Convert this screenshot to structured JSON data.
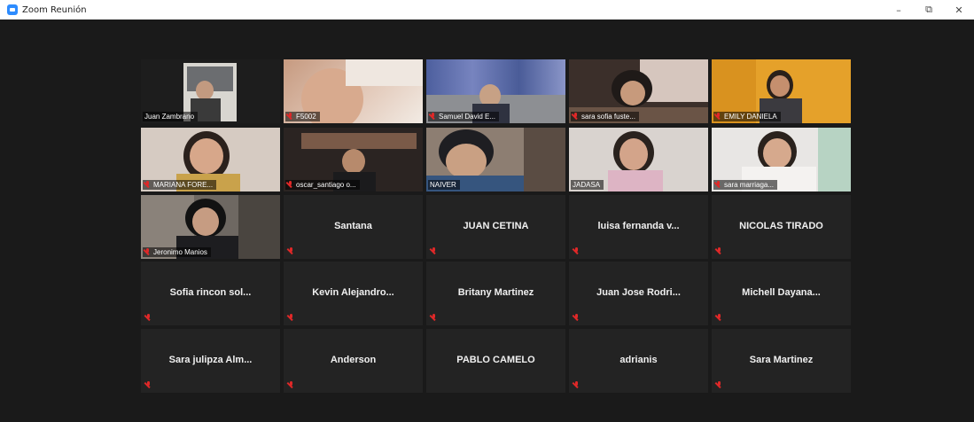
{
  "window": {
    "title": "Zoom Reunión",
    "minimize": "–",
    "restore": "⧉",
    "close": "✕"
  },
  "participants": [
    {
      "name": "Juan Zambrano",
      "label": "Juan Zambrano",
      "video": true,
      "active": true,
      "muted": false
    },
    {
      "name": "F5002",
      "label": "F5002",
      "video": true,
      "muted": true
    },
    {
      "name": "Samuel David E...",
      "label": "Samuel David E...",
      "video": true,
      "muted": true
    },
    {
      "name": "sara sofia fuste...",
      "label": "sara sofia fuste...",
      "video": true,
      "muted": true
    },
    {
      "name": "EMILY DANIELA",
      "label": "EMILY DANIELA",
      "video": true,
      "muted": true
    },
    {
      "name": "MARIANA FORE...",
      "label": "MARIANA FORE...",
      "video": true,
      "muted": true
    },
    {
      "name": "oscar_santiago o...",
      "label": "oscar_santiago o...",
      "video": true,
      "muted": true
    },
    {
      "name": "NAIVER",
      "label": "NAIVER",
      "video": true,
      "muted": false
    },
    {
      "name": "JADASA",
      "label": "JADASA",
      "video": true,
      "muted": false
    },
    {
      "name": "sara marriaga...",
      "label": "sara marriaga...",
      "video": true,
      "muted": true
    },
    {
      "name": "Jeronimo Manios",
      "label": "Jeronimo Manios",
      "video": true,
      "muted": true
    },
    {
      "name": "Santana",
      "video": false,
      "muted": true
    },
    {
      "name": "JUAN CETINA",
      "video": false,
      "muted": true
    },
    {
      "name": "luisa fernanda v...",
      "video": false,
      "muted": true
    },
    {
      "name": "NICOLAS TIRADO",
      "video": false,
      "muted": true
    },
    {
      "name": "Sofia rincon sol...",
      "video": false,
      "muted": true
    },
    {
      "name": "Kevin  Alejandro...",
      "video": false,
      "muted": true
    },
    {
      "name": "Britany Martinez",
      "video": false,
      "muted": true
    },
    {
      "name": "Juan Jose Rodri...",
      "video": false,
      "muted": true
    },
    {
      "name": "Michell  Dayana...",
      "video": false,
      "muted": true
    },
    {
      "name": "Sara julipza Alm...",
      "video": false,
      "muted": true
    },
    {
      "name": "Anderson",
      "video": false,
      "muted": true
    },
    {
      "name": "PABLO CAMELO",
      "video": false,
      "muted": false
    },
    {
      "name": "adrianis",
      "video": false,
      "muted": true
    },
    {
      "name": "Sara Martinez",
      "video": false,
      "muted": true
    }
  ]
}
